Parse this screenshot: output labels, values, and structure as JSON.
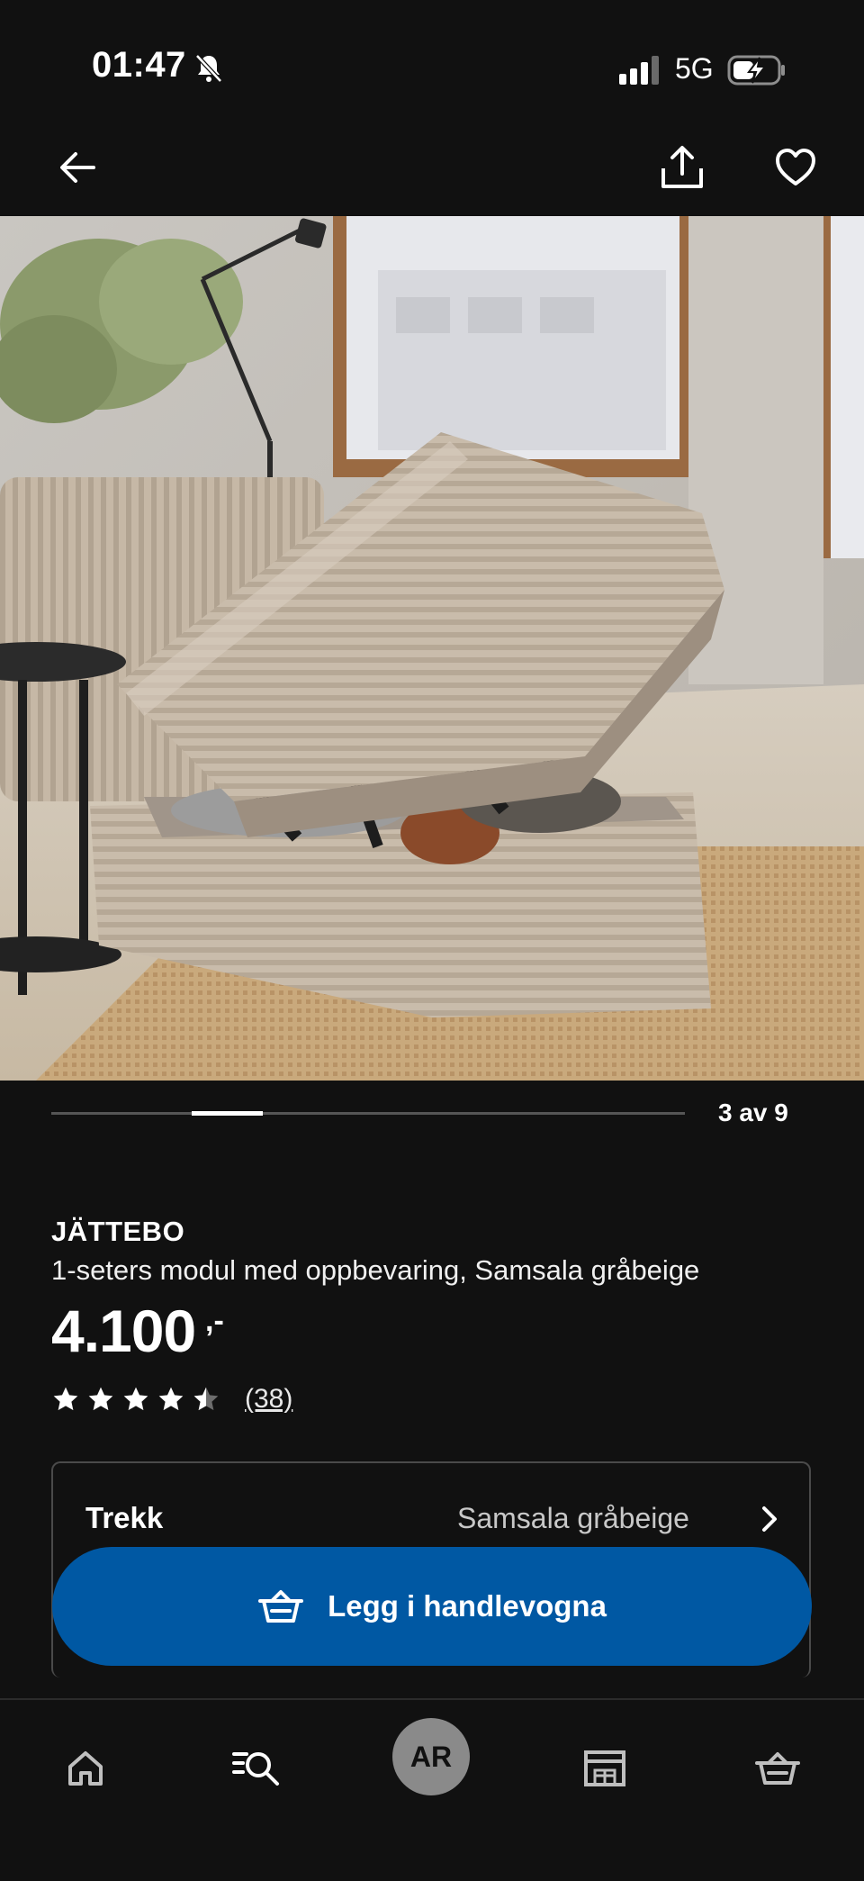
{
  "status_bar": {
    "time": "01:47",
    "network": "5G",
    "battery_level": 0.4
  },
  "header": {
    "icons": [
      "back-arrow-icon",
      "share-icon",
      "heart-icon"
    ]
  },
  "carousel": {
    "counter": "3 av 9",
    "current": 3,
    "total": 9
  },
  "product": {
    "name": "JÄTTEBO",
    "description": "1-seters modul med oppbevaring, Samsala gråbeige",
    "price": "4.100",
    "price_suffix": ",-",
    "rating": 4.5,
    "rating_max": 5,
    "reviews": "(38)"
  },
  "option": {
    "label": "Trekk",
    "value": "Samsala gråbeige"
  },
  "cta": {
    "label": "Legg i handlevogna",
    "color": "#0058a3"
  },
  "nav": {
    "items": [
      "home-icon",
      "search-list-icon",
      "ar-button",
      "store-icon",
      "basket-icon"
    ],
    "ar_label": "AR"
  },
  "colors": {
    "background": "#111111",
    "accent": "#0058a3"
  }
}
